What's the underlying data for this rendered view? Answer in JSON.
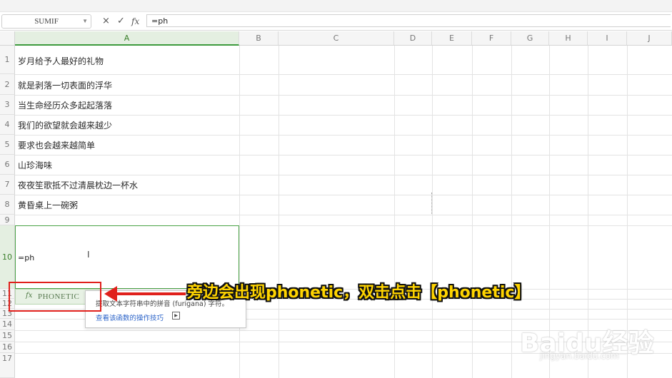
{
  "formula_bar": {
    "name_box": "SUMIF",
    "cancel_icon": "×",
    "confirm_icon": "✓",
    "fx_label": "fx",
    "formula": "=ph"
  },
  "columns": [
    "A",
    "B",
    "C",
    "D",
    "E",
    "F",
    "G",
    "H",
    "I",
    "J"
  ],
  "rows": [
    {
      "num": "1",
      "text": "岁月给予人最好的礼物"
    },
    {
      "num": "2",
      "text": "就是剥落一切表面的浮华"
    },
    {
      "num": "3",
      "text": "当生命经历众多起起落落"
    },
    {
      "num": "4",
      "text": "我们的欲望就会越来越少"
    },
    {
      "num": "5",
      "text": "要求也会越来越简单"
    },
    {
      "num": "6",
      "text": "山珍海味"
    },
    {
      "num": "7",
      "text": "夜夜笙歌抵不过清晨枕边一杯水"
    },
    {
      "num": "8",
      "text": "黄昏桌上一碗粥"
    },
    {
      "num": "9",
      "text": ""
    },
    {
      "num": "10",
      "text": "=ph"
    },
    {
      "num": "11",
      "text": ""
    },
    {
      "num": "12",
      "text": ""
    },
    {
      "num": "13",
      "text": ""
    },
    {
      "num": "14",
      "text": ""
    },
    {
      "num": "15",
      "text": ""
    },
    {
      "num": "16",
      "text": ""
    },
    {
      "num": "17",
      "text": ""
    }
  ],
  "autocomplete": {
    "fx": "fx",
    "function_name": "PHONETIC",
    "description": "提取文本字符串中的拼音 (furigana) 字符。",
    "help_link": "查看该函数的操作技巧"
  },
  "annotation": "旁边会出现phonetic，双击点击【phonetic】",
  "watermark": {
    "main": "Baidu经验",
    "sub": "jingyan.baidu.com"
  },
  "colors": {
    "accent": "#3d9a3d",
    "annotation": "#ffd400",
    "highlight": "#e0201c"
  }
}
